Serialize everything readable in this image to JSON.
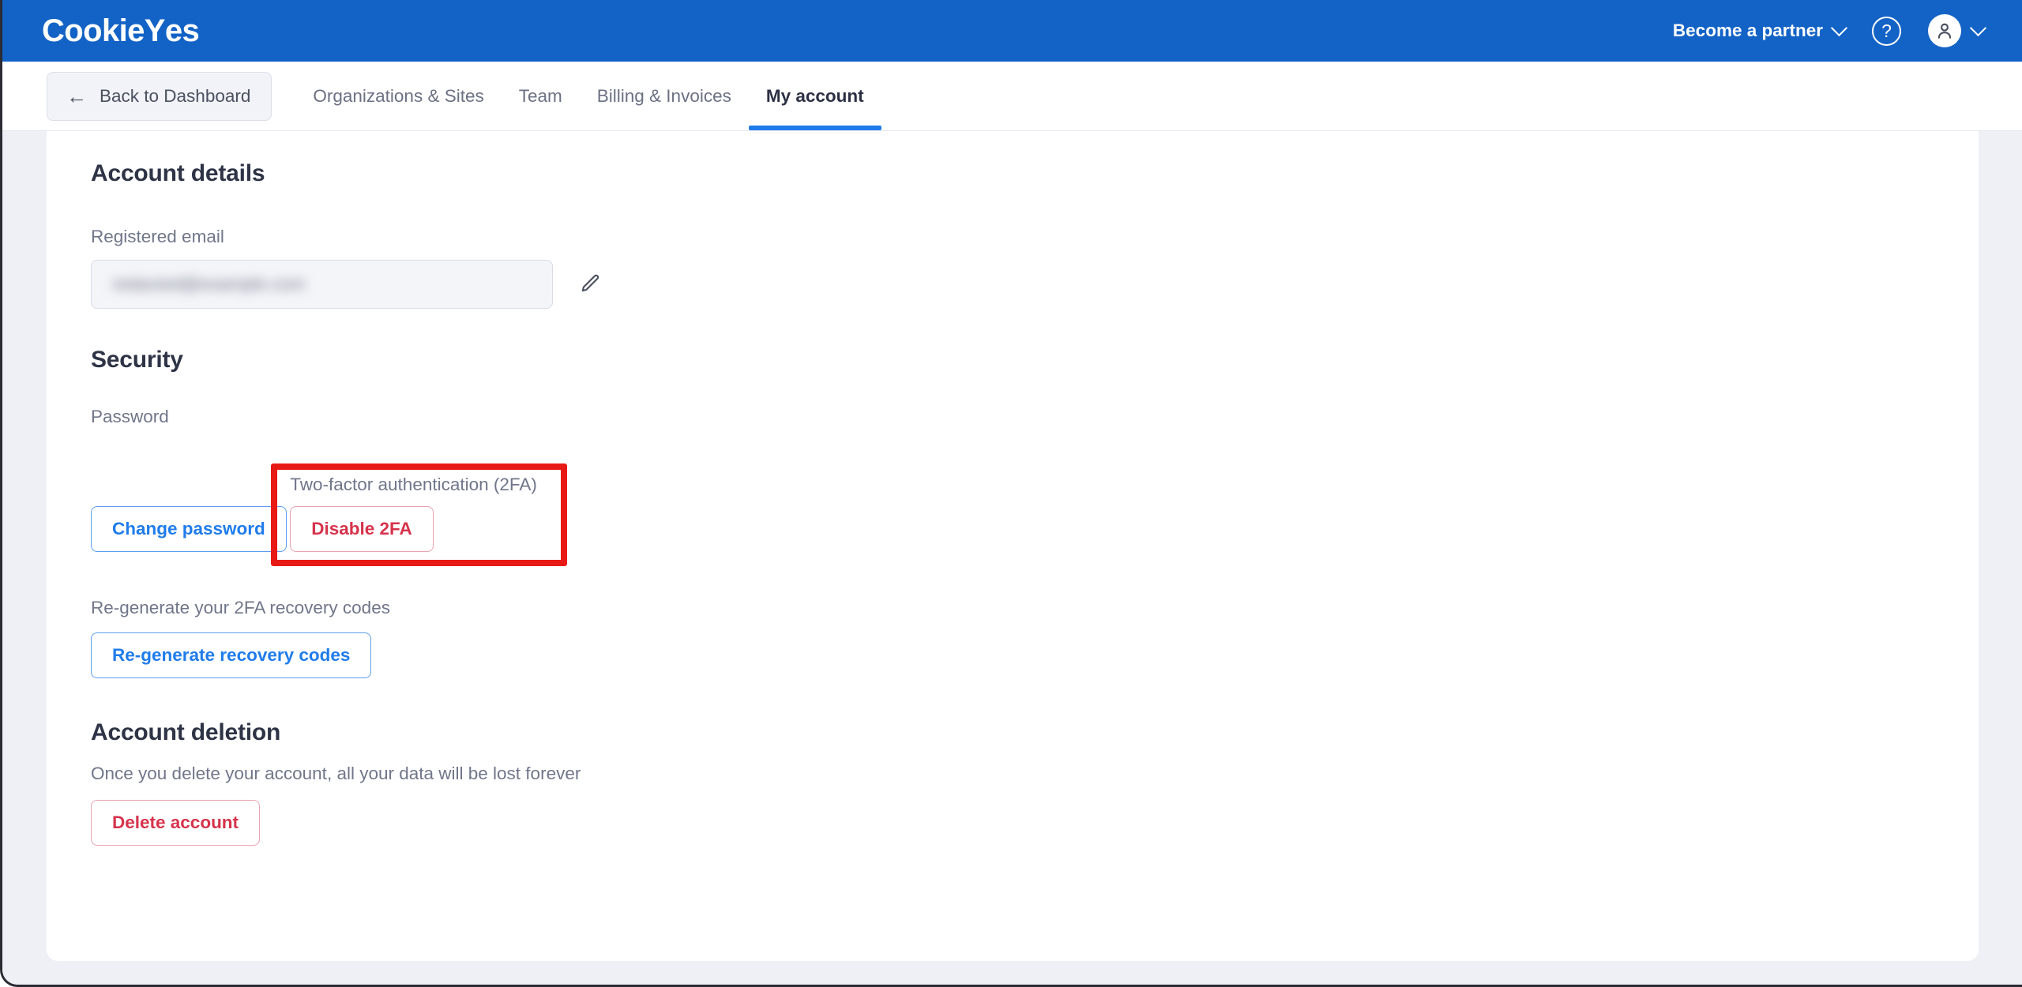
{
  "appbar": {
    "brand": "Cookie",
    "brand_accent": "Y",
    "brand_tail": "es",
    "partner_label": "Become a partner",
    "help_glyph": "?",
    "chevron_glyph": "chevron-down",
    "brand_color": "#1363c6"
  },
  "navbar": {
    "back_label": "Back to Dashboard",
    "back_arrow": "←",
    "tabs": [
      {
        "label": "Organizations & Sites",
        "active": false
      },
      {
        "label": "Team",
        "active": false
      },
      {
        "label": "Billing & Invoices",
        "active": false
      },
      {
        "label": "My account",
        "active": true
      }
    ],
    "active_underline_color": "#1f7ceb"
  },
  "account_details": {
    "title": "Account details",
    "email_label": "Registered email",
    "email_value": "redacted@example.com",
    "edit_icon": "pencil-icon"
  },
  "security": {
    "title": "Security",
    "password_label": "Password",
    "change_password_button": "Change password",
    "twofa_label": "Two-factor authentication (2FA)",
    "disable_2fa_button": "Disable 2FA",
    "recovery_label": "Re-generate your 2FA recovery codes",
    "regenerate_button": "Re-generate recovery codes"
  },
  "account_deletion": {
    "title": "Account deletion",
    "note": "Once you delete your account, all your data will be lost forever",
    "delete_button": "Delete account"
  },
  "annotation": {
    "color": "#e81a16",
    "target": "two-factor-authentication-block"
  }
}
